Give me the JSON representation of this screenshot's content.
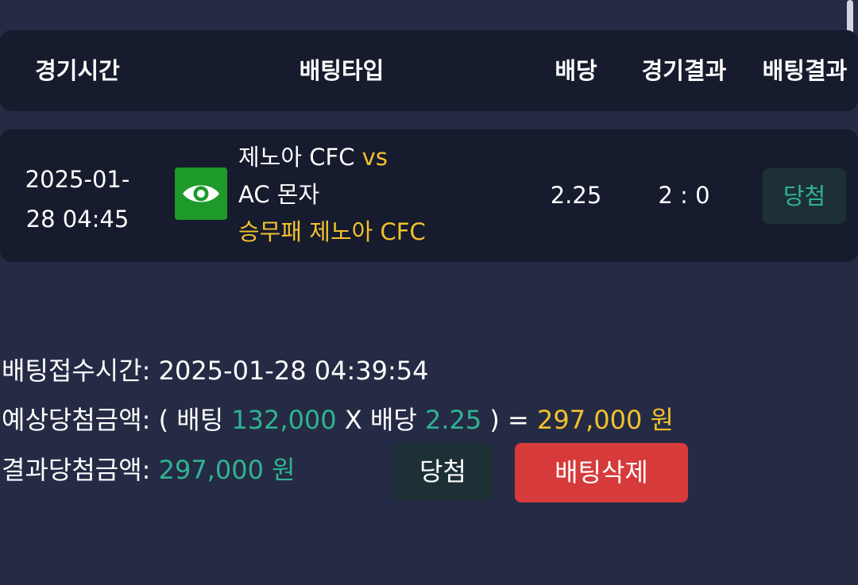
{
  "table_header": {
    "game_time": "경기시간",
    "bet_type": "배팅타입",
    "odds": "배당",
    "game_result": "경기결과",
    "bet_result": "배팅결과"
  },
  "bet_row": {
    "time_line1": "2025-01-",
    "time_line2": "28 04:45",
    "icon": "eye-icon",
    "home_team": "제노아 CFC",
    "vs": "vs",
    "away_team": "AC 몬자",
    "pick": "승무패 제노아 CFC",
    "odds": "2.25",
    "score": "2 : 0",
    "result": "당첨"
  },
  "summary": {
    "received_label": "배팅접수시간:",
    "received_value": "2025-01-28 04:39:54",
    "expected_label": "예상당첨금액:",
    "expected_open": "( 배팅",
    "expected_stake": "132,000",
    "expected_x": "X 배당",
    "expected_odds": "2.25",
    "expected_close": ") =",
    "expected_total": "297,000 원",
    "final_label": "결과당첨금액:",
    "final_value": "297,000 원",
    "win_button": "당첨",
    "delete_button": "배팅삭제"
  },
  "colors": {
    "background": "#252b44",
    "card": "#161b2d",
    "accent_yellow": "#f2c12e",
    "accent_green": "#2fb393",
    "delete_red": "#d63a3a",
    "icon_green": "#1e9a2b"
  }
}
